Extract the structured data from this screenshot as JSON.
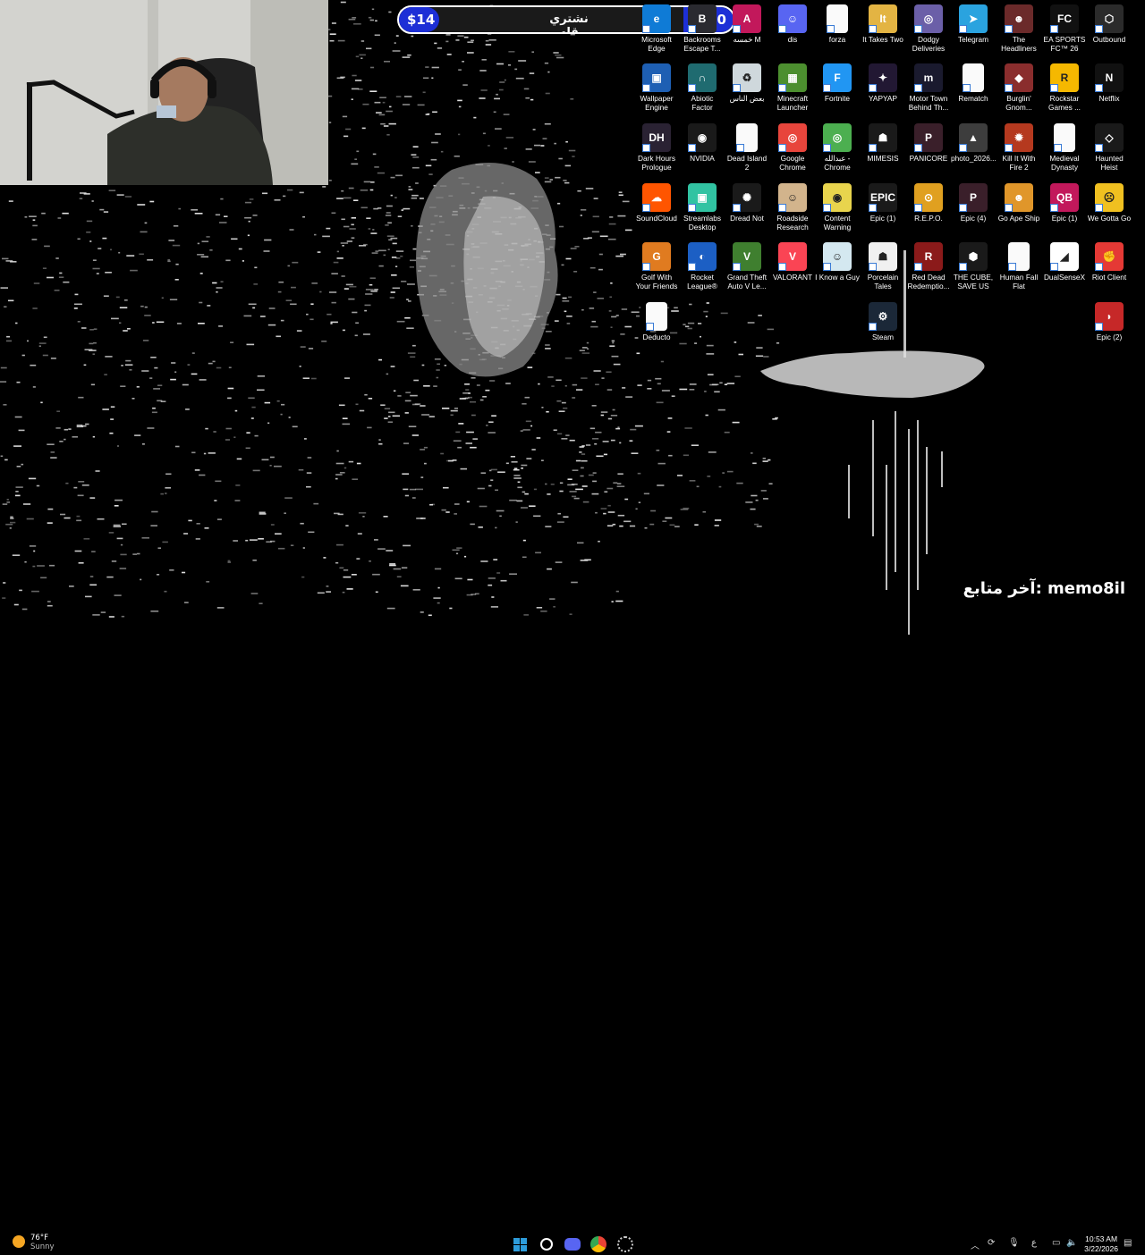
{
  "goal_bar": {
    "left_amount": "$14",
    "center_text": "نشتري قله",
    "right_amount": "$100"
  },
  "desktop_icons": [
    {
      "label": "Microsoft Edge",
      "icon": "edge-icon",
      "color": "#0f7bd6",
      "glyph": "e"
    },
    {
      "label": "Backrooms Escape T...",
      "icon": "backrooms-icon",
      "color": "#2a2a30",
      "glyph": "B"
    },
    {
      "label": "خمسه M",
      "icon": "m-icon",
      "color": "#c2185b",
      "glyph": "A"
    },
    {
      "label": "dis",
      "icon": "discord-icon",
      "color": "#5865f2",
      "glyph": "☺"
    },
    {
      "label": "forza",
      "icon": "file-icon",
      "color": "#fafafa",
      "glyph": ""
    },
    {
      "label": "It Takes Two",
      "icon": "it-takes-two-icon",
      "color": "#e3b443",
      "glyph": "It"
    },
    {
      "label": "Dodgy Deliveries",
      "icon": "dodgy-deliveries-icon",
      "color": "#6b5fa8",
      "glyph": "◎"
    },
    {
      "label": "Telegram",
      "icon": "telegram-icon",
      "color": "#2aa3df",
      "glyph": "➤"
    },
    {
      "label": "The Headliners",
      "icon": "headliners-icon",
      "color": "#6b2a2a",
      "glyph": "☻"
    },
    {
      "label": "EA SPORTS FC™ 26",
      "icon": "fc26-icon",
      "color": "#111111",
      "glyph": "FC"
    },
    {
      "label": "Outbound",
      "icon": "outbound-icon",
      "color": "#2b2b2b",
      "glyph": "⬡"
    },
    {
      "label": "Wallpaper Engine",
      "icon": "wallpaper-engine-icon",
      "color": "#1e5fb3",
      "glyph": "▣"
    },
    {
      "label": "Abiotic Factor",
      "icon": "abiotic-factor-icon",
      "color": "#1f6b70",
      "glyph": "∩"
    },
    {
      "label": "بعض الناس",
      "icon": "recycle-bin-icon",
      "color": "#cfd8dc",
      "glyph": "♻"
    },
    {
      "label": "Minecraft Launcher",
      "icon": "minecraft-icon",
      "color": "#4c8f2f",
      "glyph": "▦"
    },
    {
      "label": "Fortnite",
      "icon": "fortnite-icon",
      "color": "#2196f3",
      "glyph": "F"
    },
    {
      "label": "YAPYAP",
      "icon": "yapyap-icon",
      "color": "#221833",
      "glyph": "✦"
    },
    {
      "label": "Motor Town Behind Th...",
      "icon": "motor-town-icon",
      "color": "#1a1a2e",
      "glyph": "m"
    },
    {
      "label": "Rematch",
      "icon": "file-icon",
      "color": "#fafafa",
      "glyph": ""
    },
    {
      "label": "Burglin' Gnom...",
      "icon": "burglin-gnomes-icon",
      "color": "#8a2d2d",
      "glyph": "◆"
    },
    {
      "label": "Rockstar Games ...",
      "icon": "rockstar-icon",
      "color": "#f5b800",
      "glyph": "R"
    },
    {
      "label": "Netflix",
      "icon": "netflix-icon",
      "color": "#111111",
      "glyph": "N"
    },
    {
      "label": "Dark Hours Prologue",
      "icon": "dark-hours-icon",
      "color": "#2a2233",
      "glyph": "DH"
    },
    {
      "label": "NVIDIA",
      "icon": "nvidia-icon",
      "color": "#1a1a1a",
      "glyph": "◉"
    },
    {
      "label": "Dead Island 2",
      "icon": "file-icon",
      "color": "#fafafa",
      "glyph": ""
    },
    {
      "label": "Google Chrome",
      "icon": "chrome-icon",
      "color": "#e8453c",
      "glyph": "◎"
    },
    {
      "label": "عبدالله - Chrome",
      "icon": "chrome-profile-icon",
      "color": "#4caf50",
      "glyph": "◎"
    },
    {
      "label": "MIMESIS",
      "icon": "mimesis-icon",
      "color": "#1a1a1a",
      "glyph": "☗"
    },
    {
      "label": "PANICORE",
      "icon": "panicore-icon",
      "color": "#3a1f2a",
      "glyph": "P"
    },
    {
      "label": "photo_2026...",
      "icon": "photo-icon",
      "color": "#3d3d3d",
      "glyph": "▲"
    },
    {
      "label": "Kill It With Fire 2",
      "icon": "kill-it-with-fire-icon",
      "color": "#b5391f",
      "glyph": "✹"
    },
    {
      "label": "Medieval Dynasty",
      "icon": "file-icon",
      "color": "#fafafa",
      "glyph": ""
    },
    {
      "label": "Haunted Heist",
      "icon": "haunted-heist-icon",
      "color": "#1a1a1a",
      "glyph": "◇"
    },
    {
      "label": "SoundCloud",
      "icon": "soundcloud-icon",
      "color": "#ff5500",
      "glyph": "☁"
    },
    {
      "label": "Streamlabs Desktop",
      "icon": "streamlabs-icon",
      "color": "#31c3a2",
      "glyph": "▣"
    },
    {
      "label": "Dread Not",
      "icon": "dread-not-icon",
      "color": "#1a1a1a",
      "glyph": "✺"
    },
    {
      "label": "Roadside Research",
      "icon": "roadside-research-icon",
      "color": "#d2b48c",
      "glyph": "☺"
    },
    {
      "label": "Content Warning",
      "icon": "content-warning-icon",
      "color": "#e8d44d",
      "glyph": "◉"
    },
    {
      "label": "Epic (1)",
      "icon": "epic-games-icon",
      "color": "#1a1a1a",
      "glyph": "EPIC"
    },
    {
      "label": "R.E.P.O.",
      "icon": "repo-icon",
      "color": "#e0a020",
      "glyph": "⊙"
    },
    {
      "label": "Epic (4)",
      "icon": "epic-games-icon",
      "color": "#3a1f2a",
      "glyph": "P"
    },
    {
      "label": "Go Ape Ship",
      "icon": "go-ape-ship-icon",
      "color": "#e0962a",
      "glyph": "☻"
    },
    {
      "label": "Epic (1)",
      "icon": "epic-games-icon",
      "color": "#c2185b",
      "glyph": "QB"
    },
    {
      "label": "We Gotta Go",
      "icon": "we-gotta-go-icon",
      "color": "#f0c020",
      "glyph": "☹"
    },
    {
      "label": "Golf With Your Friends",
      "icon": "golf-icon",
      "color": "#e07b20",
      "glyph": "G"
    },
    {
      "label": "Rocket League®",
      "icon": "rocket-league-icon",
      "color": "#1c5fc4",
      "glyph": "◐"
    },
    {
      "label": "Grand Theft Auto V Le...",
      "icon": "gta-icon",
      "color": "#3f7f2f",
      "glyph": "V"
    },
    {
      "label": "VALORANT",
      "icon": "valorant-icon",
      "color": "#fa4454",
      "glyph": "V"
    },
    {
      "label": "I Know a Guy",
      "icon": "i-know-a-guy-icon",
      "color": "#d4e8f0",
      "glyph": "☺"
    },
    {
      "label": "Porcelain Tales",
      "icon": "porcelain-tales-icon",
      "color": "#f0f0f0",
      "glyph": "☗"
    },
    {
      "label": "Red Dead Redemptio...",
      "icon": "red-dead-icon",
      "color": "#8b1a1a",
      "glyph": "R"
    },
    {
      "label": "THE CUBE, SAVE US",
      "icon": "the-cube-icon",
      "color": "#1a1a1a",
      "glyph": "⬢"
    },
    {
      "label": "Human Fall Flat",
      "icon": "file-icon",
      "color": "#fafafa",
      "glyph": ""
    },
    {
      "label": "DualSenseX",
      "icon": "dualsensex-icon",
      "color": "#ffffff",
      "glyph": "◢"
    },
    {
      "label": "Riot Client",
      "icon": "riot-client-icon",
      "color": "#e53935",
      "glyph": "✊"
    },
    {
      "label": "Deducto",
      "icon": "file-icon",
      "color": "#fafafa",
      "glyph": ""
    },
    {
      "label": "Steam",
      "icon": "steam-icon",
      "color": "#1b2838",
      "glyph": "⚙"
    },
    {
      "label": "Epic (2)",
      "icon": "among-us-icon",
      "color": "#c62828",
      "glyph": "◗"
    }
  ],
  "follower": {
    "text": "آخر متابع: memo8il"
  },
  "taskbar": {
    "weather_temp": "76°F",
    "weather_desc": "Sunny",
    "time": "10:53 AM",
    "date": "3/22/2026",
    "lang": "ع",
    "chrome_badge": ""
  },
  "colors": {
    "goal_blue": "#1d2fd6",
    "windows_blue": "#2d9cdb"
  }
}
